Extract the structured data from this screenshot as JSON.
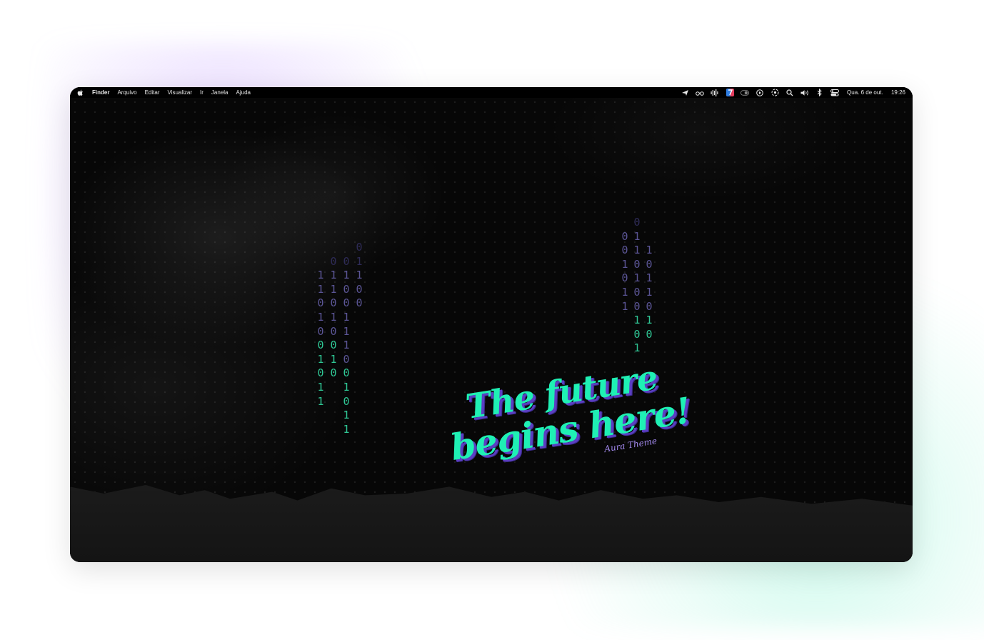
{
  "menubar": {
    "apple_icon": "apple-logo-icon",
    "app_name": "Finder",
    "menus": [
      "Arquivo",
      "Editar",
      "Visualizar",
      "Ir",
      "Janela",
      "Ajuda"
    ],
    "status_icons": [
      "location-arrow-icon",
      "glasses-icon",
      "audio-waveform-icon",
      "app-badge-icon",
      "toggle-icon",
      "play-circle-icon",
      "focus-icon",
      "search-icon",
      "volume-icon",
      "bluetooth-icon",
      "control-center-icon"
    ],
    "date": "Qua. 6 de out.",
    "time": "19:26"
  },
  "wallpaper": {
    "headline_line1": "The future",
    "headline_line2": "begins here!",
    "subtitle": "Aura Theme",
    "colors": {
      "accent_green": "#1ff0b4",
      "accent_purple": "#5b3fc2",
      "dim_purple": "#5b5596",
      "binary_green": "#2fc795"
    },
    "binary_left": [
      [
        "",
        "",
        "1",
        "1",
        "0",
        "1",
        "0",
        "0",
        "1",
        "0",
        "1",
        "1"
      ],
      [
        "",
        "0",
        "1",
        "1",
        "0",
        "1",
        "0",
        "0",
        "1",
        "0",
        "",
        ""
      ],
      [
        "",
        "0",
        "1",
        "0",
        "0",
        "1",
        "1",
        "1",
        "0",
        "0",
        "1",
        "0",
        "1",
        "1"
      ],
      [
        "0",
        "1",
        "1",
        "0",
        "0",
        "",
        "",
        "",
        "",
        "",
        "",
        ""
      ]
    ],
    "binary_right": [
      [
        "",
        "0",
        "0",
        "1",
        "0",
        "1",
        "1",
        "",
        "",
        ""
      ],
      [
        "0",
        "1",
        "1",
        "0",
        "1",
        "0",
        "0",
        "1",
        "0",
        "1"
      ],
      [
        "",
        "",
        "1",
        "0",
        "1",
        "1",
        "0",
        "1",
        "0",
        ""
      ]
    ]
  }
}
